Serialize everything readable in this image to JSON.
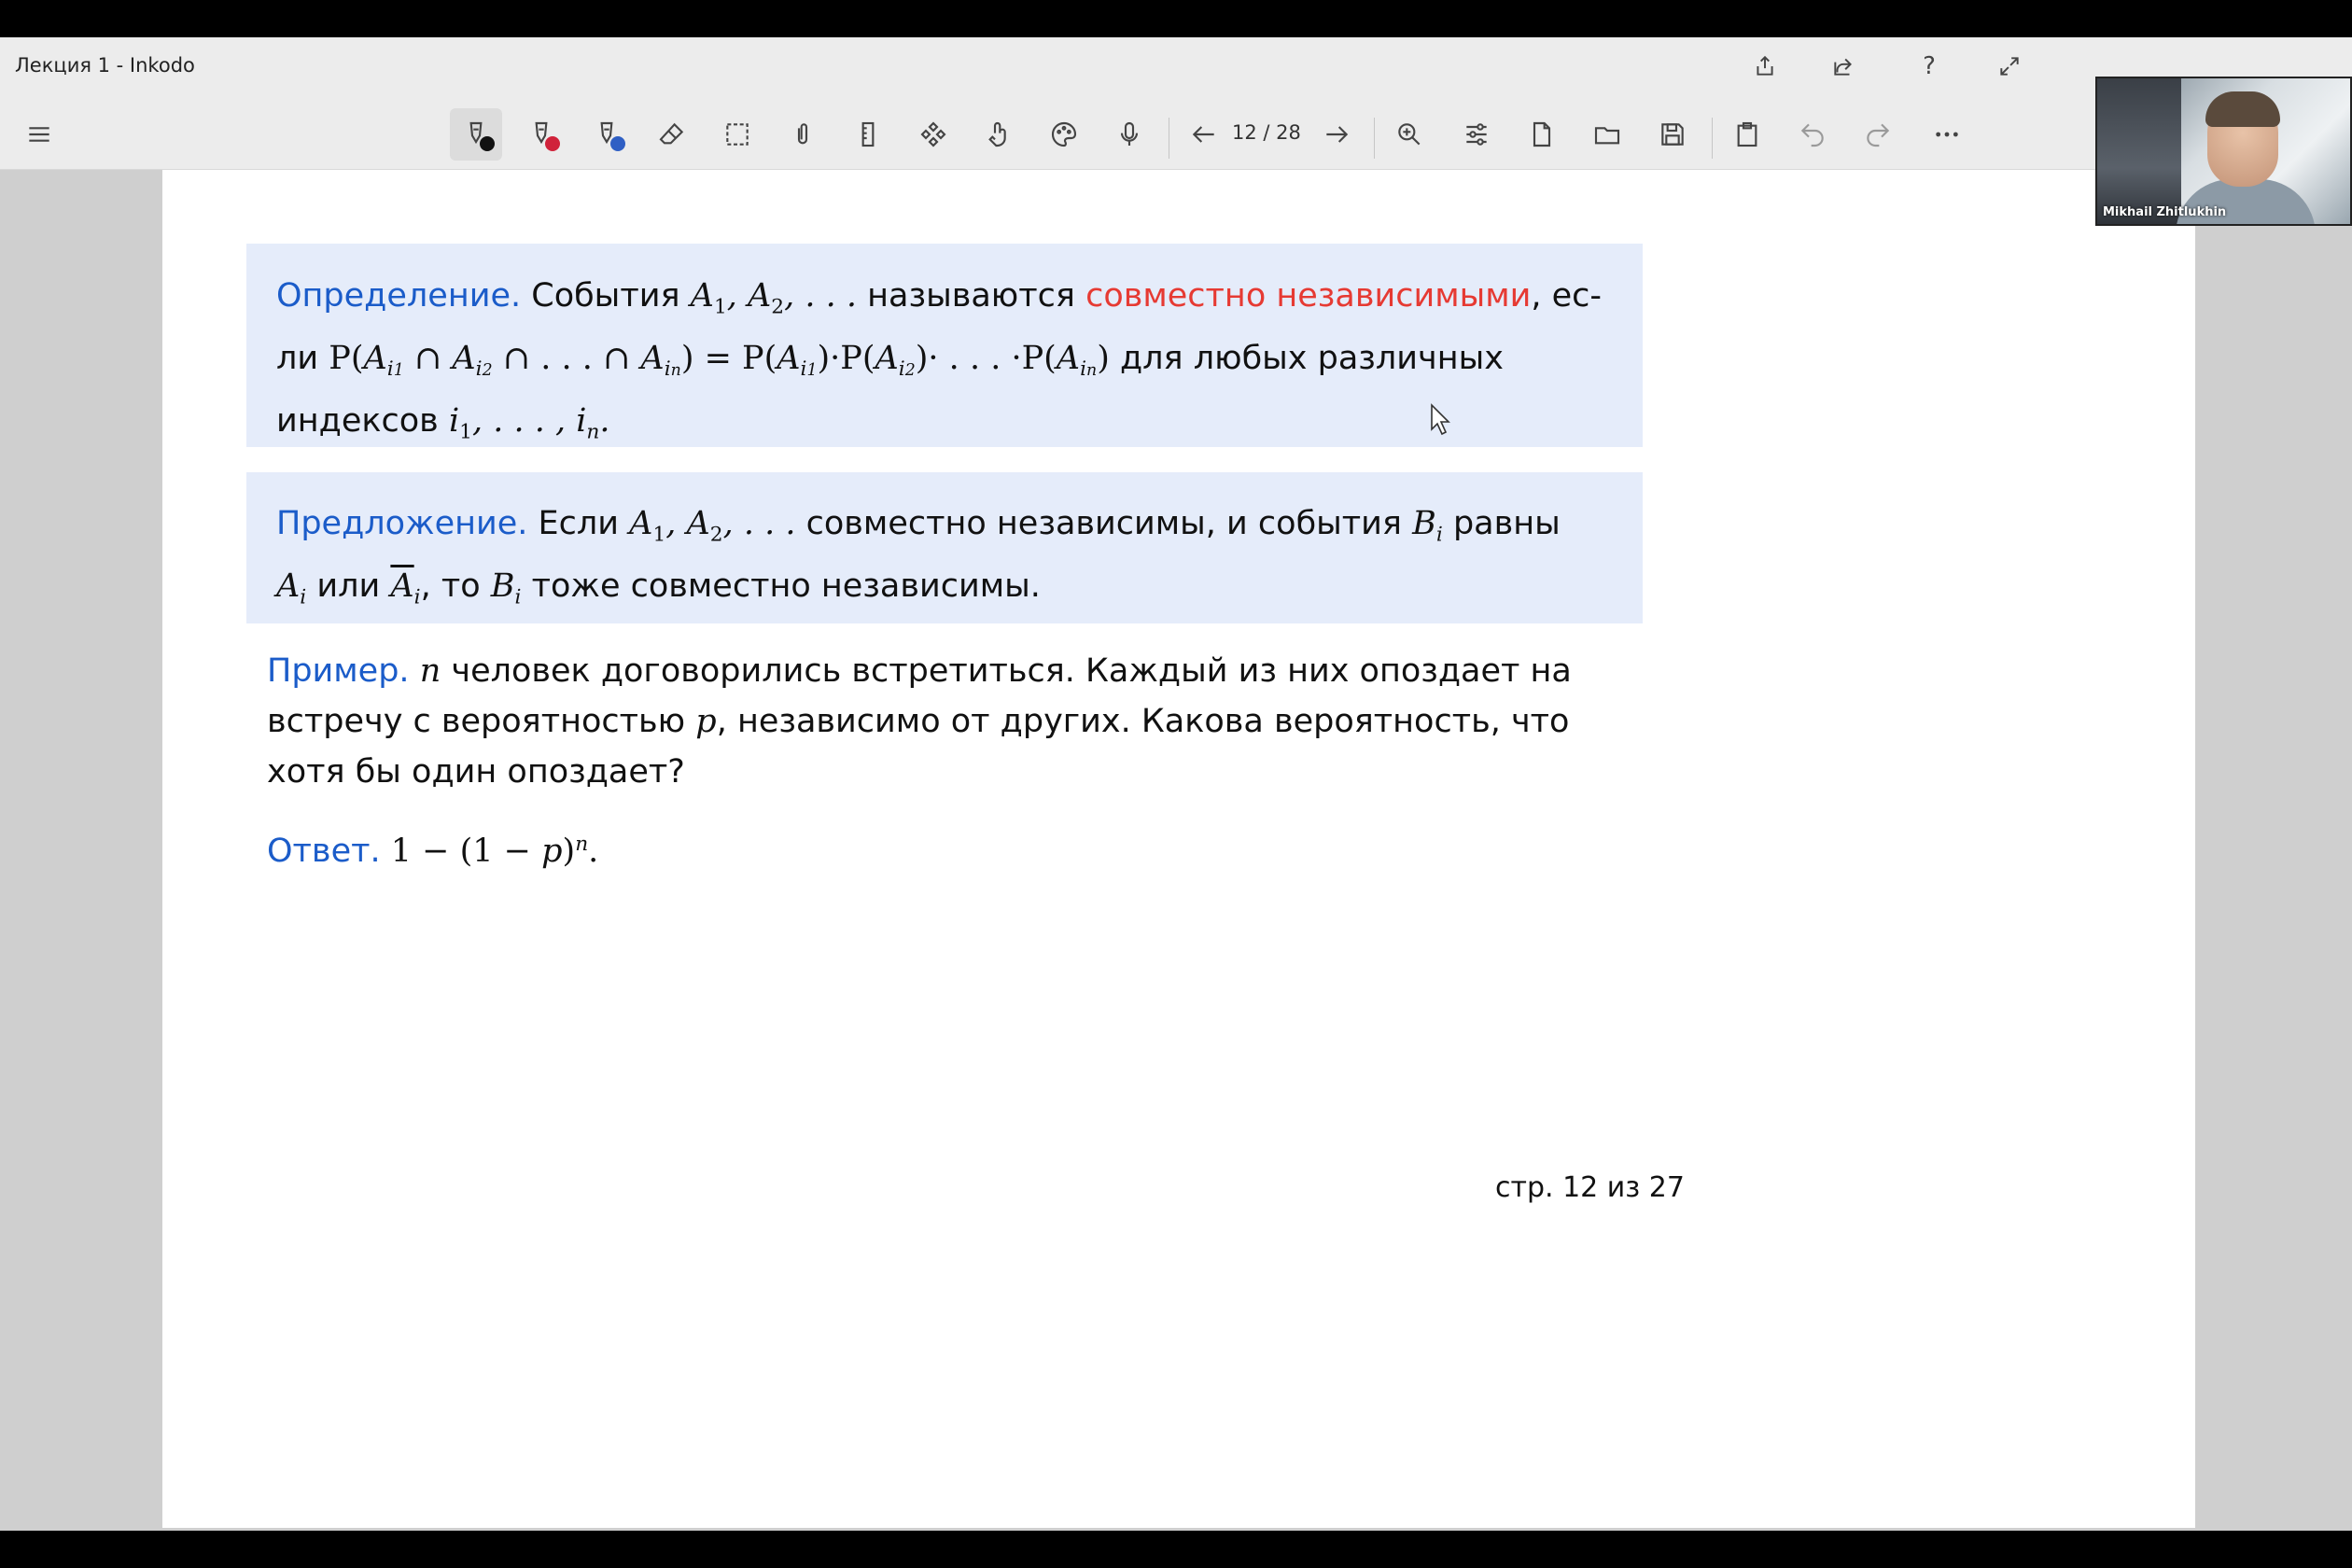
{
  "window": {
    "title": "Лекция 1 - Inkodo"
  },
  "titlebar_icons": [
    "share-out-icon",
    "share-icon",
    "help-icon",
    "expand-icon"
  ],
  "titlebar_help": "?",
  "toolbar": {
    "page_counter": "12 / 28",
    "pen_colors": [
      "#111111",
      "#d0223a",
      "#2f5fc4"
    ]
  },
  "webcam": {
    "name": "Mikhail Zhitlukhin"
  },
  "document": {
    "definition": {
      "label": "Определение.",
      "text1": "События",
      "text2": "называются",
      "highlight": "совместно независимыми",
      "text3": ", ес-",
      "line2_start": "ли",
      "line2_end": "для любых различных",
      "line3_start": "индексов"
    },
    "proposition": {
      "label": "Предложение.",
      "text1": "Если",
      "text2": "совместно независимы, и события",
      "text3": "равны",
      "text4": "или",
      "text5": ", то",
      "text6": "тоже совместно независимы."
    },
    "example": {
      "label": "Пример.",
      "line1": "человек договорились встретиться. Каждый из них опоздает на",
      "line2a": "встречу с вероятностью",
      "line2b": ", независимо от других. Какова вероятность, что",
      "line3": "хотя бы один опоздает?"
    },
    "answer": {
      "label": "Ответ."
    },
    "footer": "стр. 12 из 27"
  },
  "colors": {
    "label_blue": "#1b5cc9",
    "highlight_red": "#e63a33",
    "box_bg": "#e5ecfa"
  }
}
